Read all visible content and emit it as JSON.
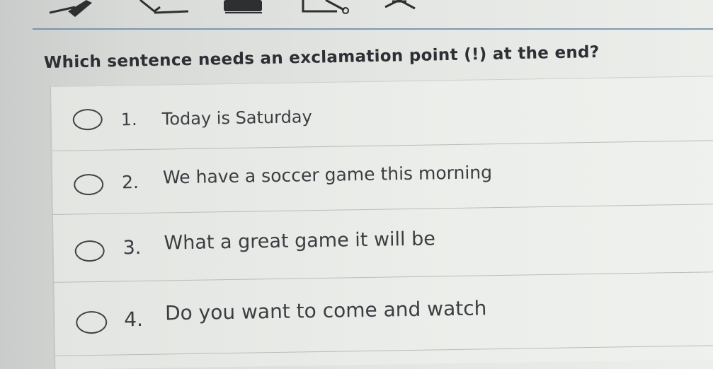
{
  "toolbar": {
    "icons": [
      "pen-icon",
      "highlighter-icon",
      "eraser-icon",
      "line-icon",
      "collapse-icon"
    ]
  },
  "question": {
    "text": "Which sentence needs an exclamation point (!) at the end?"
  },
  "options": [
    {
      "number": "1.",
      "text": "Today is Saturday"
    },
    {
      "number": "2.",
      "text": "We have a soccer game this morning"
    },
    {
      "number": "3.",
      "text": "What a great game it will be"
    },
    {
      "number": "4.",
      "text": "Do you want to come and watch"
    }
  ],
  "colors": {
    "text": "#3b3e41",
    "rule": "#5d7fa0"
  }
}
